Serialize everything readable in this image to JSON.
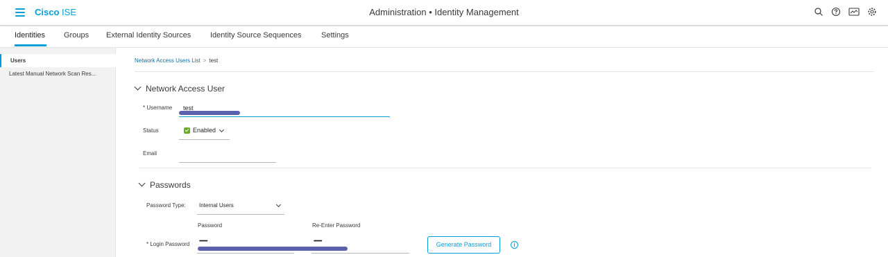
{
  "header": {
    "brand_main": "Cisco",
    "brand_suffix": "ISE",
    "title": "Administration • Identity Management",
    "icons": [
      "search-icon",
      "help-icon",
      "dashboard-icon",
      "settings-icon"
    ]
  },
  "tabs": [
    {
      "label": "Identities",
      "active": true
    },
    {
      "label": "Groups"
    },
    {
      "label": "External Identity Sources"
    },
    {
      "label": "Identity Source Sequences"
    },
    {
      "label": "Settings"
    }
  ],
  "sidebar": {
    "items": [
      {
        "label": "Users",
        "active": true
      },
      {
        "label": "Latest Manual Network Scan Res..."
      }
    ]
  },
  "breadcrumb": {
    "parent": "Network Access Users List",
    "current": "test"
  },
  "network_access_user": {
    "section_title": "Network Access User",
    "username_label": "* Username",
    "username_value": "test",
    "status_label": "Status",
    "status_value": "Enabled",
    "email_label": "Email",
    "email_value": ""
  },
  "passwords": {
    "section_title": "Passwords",
    "password_type_label": "Password Type:",
    "password_type_value": "Internal Users",
    "password_col_label": "Password",
    "reenter_col_label": "Re-Enter Password",
    "login_password_label": "* Login Password",
    "password_mask": "••••••••",
    "reenter_mask": "••••••••",
    "generate_button": "Generate Password",
    "info_glyph": "i"
  },
  "colors": {
    "accent": "#049fd9",
    "link": "#0d6fa3",
    "enabled_check": "#6aab2c",
    "redaction": "#5b61ad"
  }
}
